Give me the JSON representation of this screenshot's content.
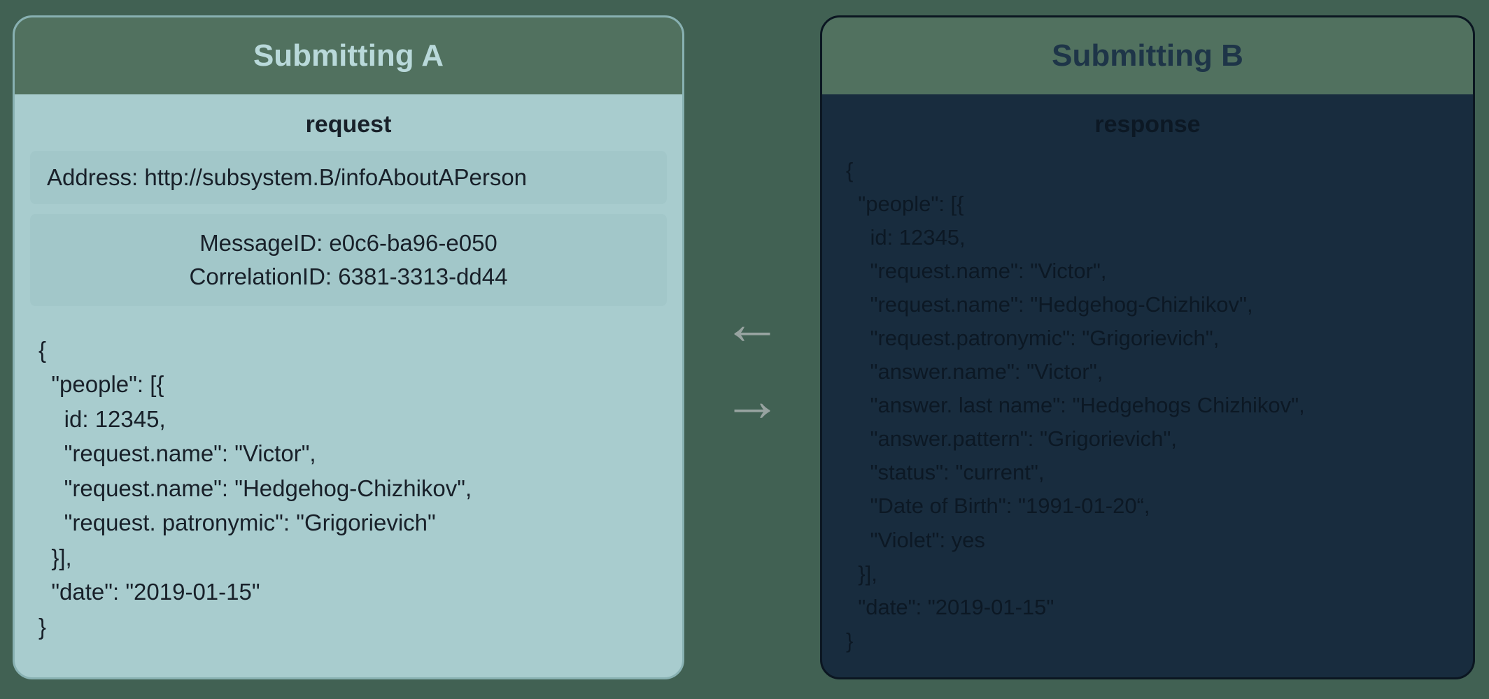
{
  "left": {
    "title": "Submitting A",
    "subtitle": "request",
    "address_line": "Address: http://subsystem.B/infoAboutAPerson",
    "message_id_line": "MessageID: e0c6-ba96-e050",
    "correlation_id_line": "CorrelationID:  6381-3313-dd44",
    "json_body": "{\n  \"people\": [{\n    id: 12345,\n    \"request.name\": \"Victor\",\n    \"request.name\": \"Hedgehog-Chizhikov\",\n    \"request. patronymic\": \"Grigorievich\"\n  }],\n  \"date\": \"2019-01-15\"\n}"
  },
  "right": {
    "title": "Submitting B",
    "subtitle": "response",
    "json_body": "{\n  \"people\": [{\n    id: 12345,\n    \"request.name\": \"Victor\",\n    \"request.name\": \"Hedgehog-Chizhikov\",\n    \"request.patronymic\": \"Grigorievich\",\n    \"answer.name\": \"Victor\",\n    \"answer. last name\": \"Hedgehogs Chizhikov\",\n    \"answer.pattern\": \"Grigorievich\",\n    \"status\": \"current\",\n    \"Date of Birth\": \"1991-01-20“,\n    \"Violet\": yes\n  }],\n  \"date\": \"2019-01-15\"\n}"
  },
  "arrows": {
    "left_glyph": "←",
    "right_glyph": "→"
  }
}
